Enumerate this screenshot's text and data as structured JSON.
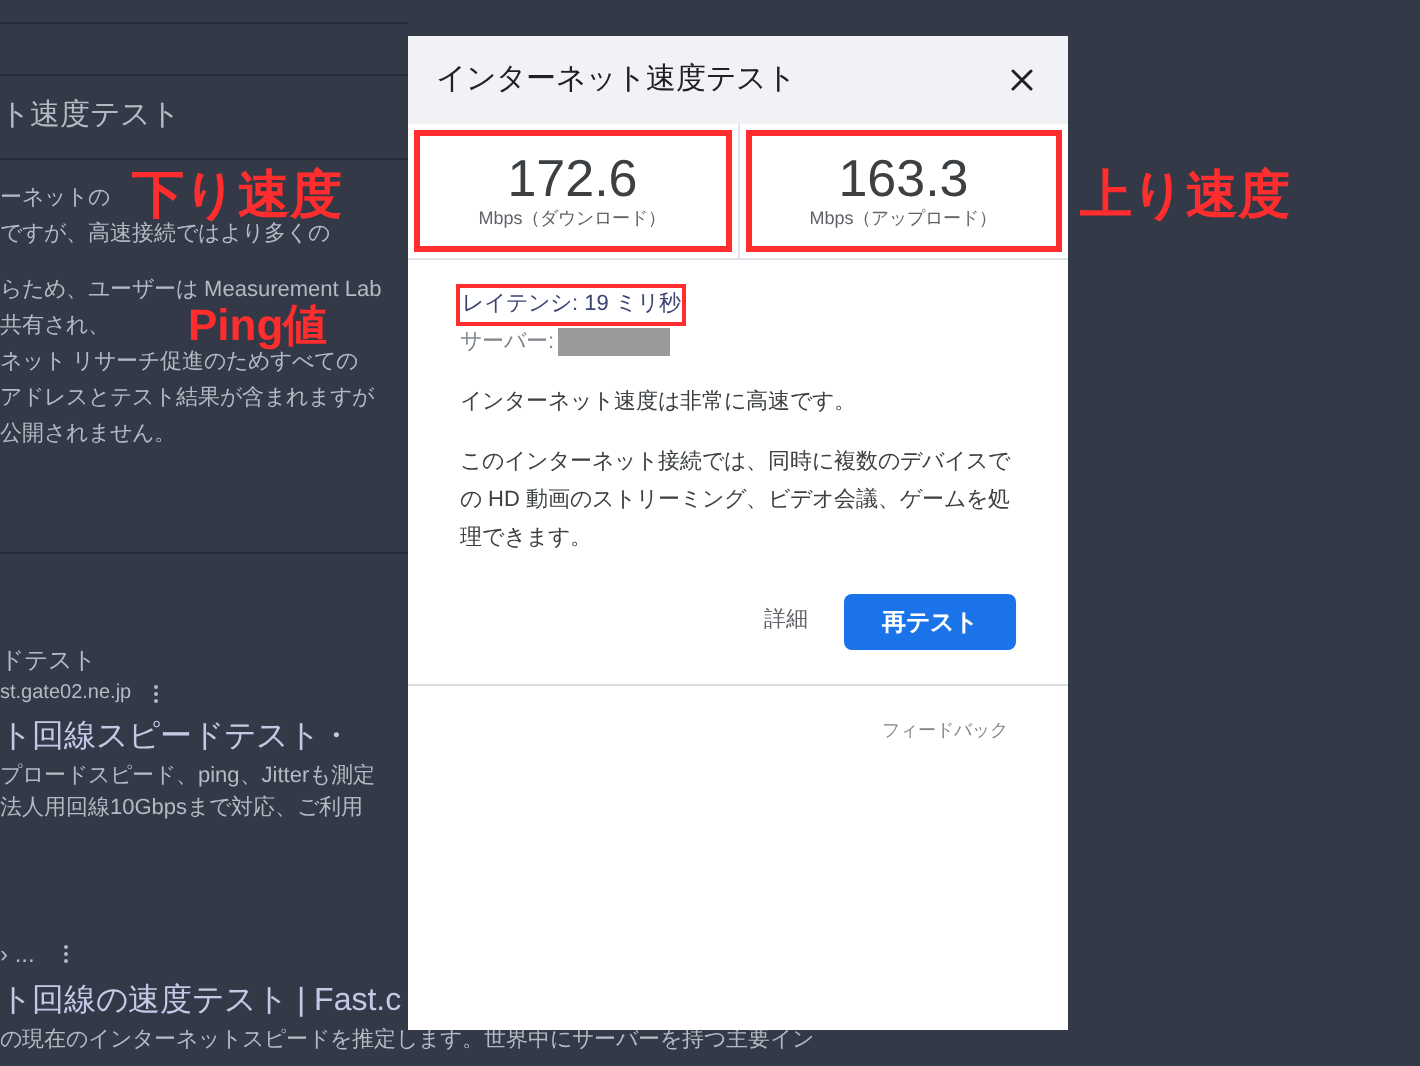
{
  "background": {
    "heading": "ト速度テスト",
    "paragraph_lines": [
      "ーネットの",
      "ですが、高速接続ではより多くの",
      "らため、ユーザーは Measurement Lab",
      "共有され、",
      "ネット リサーチ促進のためすべての",
      "アドレスとテスト結果が含まれますが",
      "公開されません。"
    ]
  },
  "search_results": [
    {
      "source": "ドテスト",
      "url": "st.gate02.ne.jp",
      "title": "ト回線スピードテスト・",
      "snippet_lines": [
        "プロードスピード、ping、Jitterも測定",
        "法人用回線10Gbpsまで対応、ご利用"
      ]
    },
    {
      "source": "› ...",
      "title": "ト回線の速度テスト | Fast.c",
      "snippet_lines": [
        "の現在のインターネットスピードを推定します。世界中にサーバーを持つ主要イン"
      ]
    }
  ],
  "dialog": {
    "title": "インターネット速度テスト",
    "stats": [
      {
        "value": "172.6",
        "unit": "Mbps（ダウンロード）"
      },
      {
        "value": "163.3",
        "unit": "Mbps（アップロード）"
      }
    ],
    "latency": "レイテンシ: 19 ミリ秒",
    "server_label": "サーバー:",
    "summary": "インターネット速度は非常に高速です。",
    "description": "このインターネット接続では、同時に複数のデバイスでの HD 動画のストリーミング、ビデオ会議、ゲームを処理できます。",
    "details_button": "詳細",
    "retest_button": "再テスト",
    "feedback_link": "フィードバック"
  },
  "annotations": [
    {
      "text": "下り速度"
    },
    {
      "text": "Ping値"
    },
    {
      "text": "上り速度"
    }
  ]
}
